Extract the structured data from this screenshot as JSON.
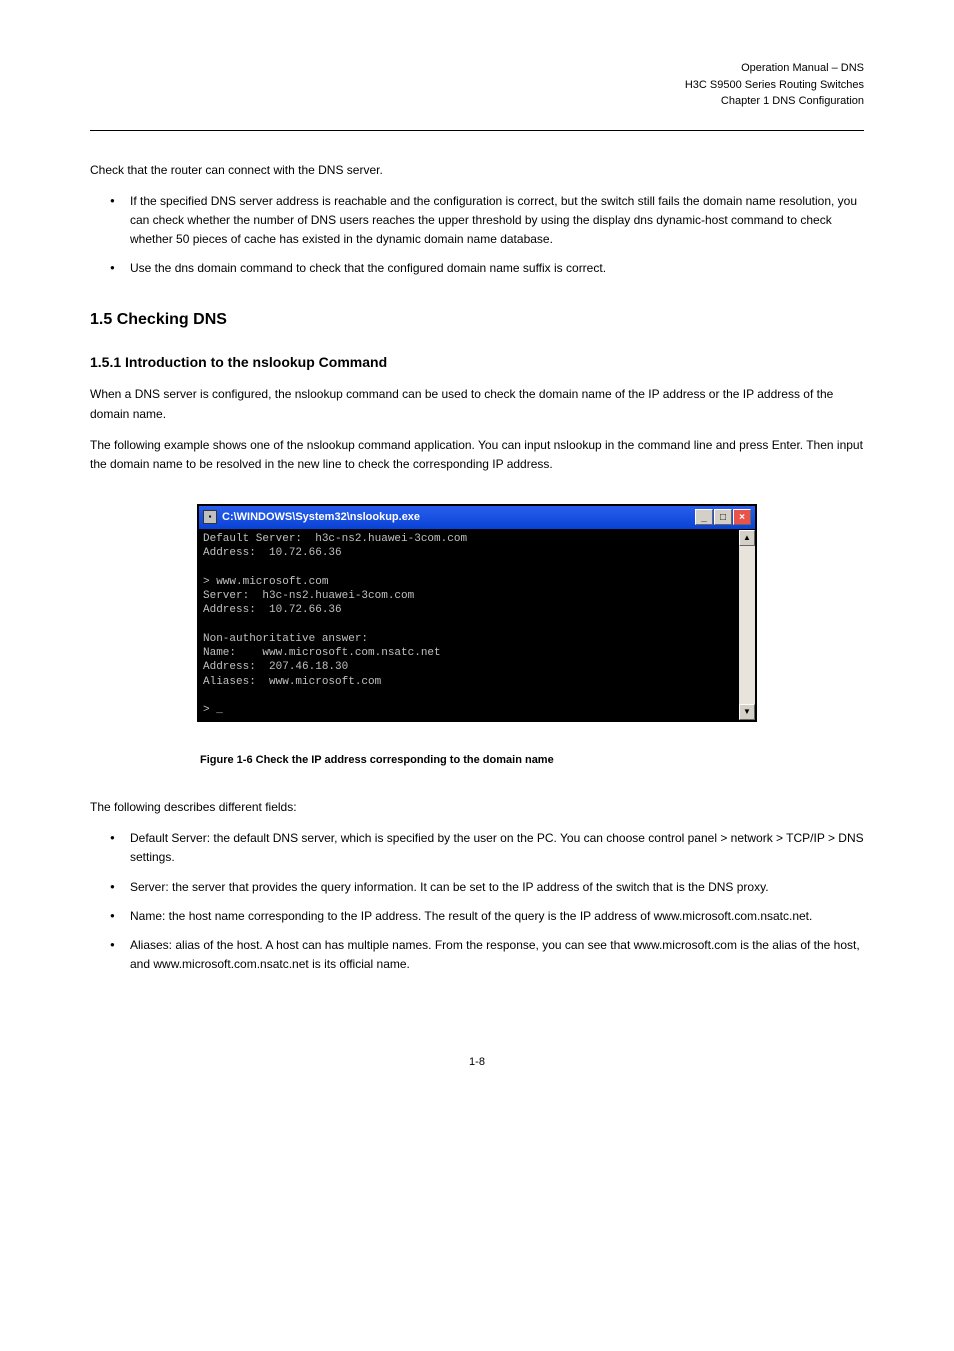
{
  "header": {
    "chapter": "Chapter 1 DNS Configuration",
    "manual": "Operation Manual – DNS",
    "product": "H3C S9500 Series Routing Switches"
  },
  "intro_text": "Check that the router can connect with the DNS server.",
  "bullets": [
    "If the specified DNS server address is reachable and the configuration is correct, but the switch still fails the domain name resolution, you can check whether the number of DNS users reaches the upper threshold by using the display dns dynamic-host command to check whether 50 pieces of cache has existed in the dynamic domain name database.",
    "Use the dns domain command to check that the configured domain name suffix is correct."
  ],
  "checking_title": "1.5  Checking DNS",
  "checking_subtitle": "1.5.1  Introduction to the nslookup Command",
  "checking_text": "When a DNS server is configured, the nslookup command can be used to check the domain name of the IP address or the IP address of the domain name.",
  "example_text": "The following example shows one of the nslookup command application. You can input nslookup in the command line and press Enter. Then input the domain name to be resolved in the new line to check the corresponding IP address.",
  "cmd": {
    "title": "C:\\WINDOWS\\System32\\nslookup.exe",
    "content": "Default Server:  h3c-ns2.huawei-3com.com\nAddress:  10.72.66.36\n\n> www.microsoft.com\nServer:  h3c-ns2.huawei-3com.com\nAddress:  10.72.66.36\n\nNon-authoritative answer:\nName:    www.microsoft.com.nsatc.net\nAddress:  207.46.18.30\nAliases:  www.microsoft.com\n\n> _"
  },
  "figure_caption": "Figure 1-6 Check the IP address corresponding to the domain name",
  "fields_intro": "The following describes different fields:",
  "fields": [
    "Default Server: the default DNS server, which is specified by the user on the PC. You can choose control panel > network > TCP/IP > DNS settings.",
    "Server: the server that provides the query information. It can be set to the IP address of the switch that is the DNS proxy.",
    "Name: the host name corresponding to the IP address. The result of the query is the IP address of www.microsoft.com.nsatc.net.",
    "Aliases: alias of the host. A host can has multiple names. From the response, you can see that www.microsoft.com is the alias of the host, and www.microsoft.com.nsatc.net is its official name."
  ],
  "page_number": "1-8"
}
